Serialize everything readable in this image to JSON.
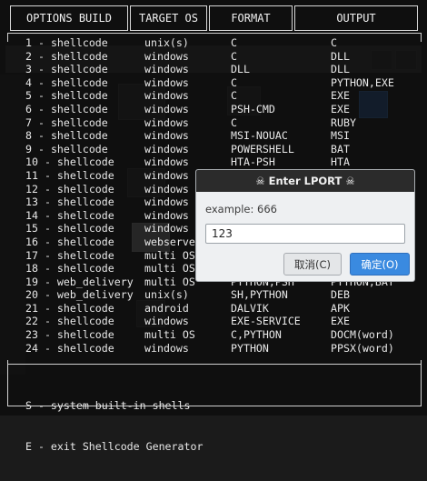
{
  "header": {
    "col1": "OPTIONS BUILD",
    "col2": "TARGET OS",
    "col3": "FORMAT",
    "col4": "OUTPUT"
  },
  "rows": [
    {
      "num": "1",
      "opt": "shellcode",
      "os": "unix(s)",
      "format": "C",
      "output": "C"
    },
    {
      "num": "2",
      "opt": "shellcode",
      "os": "windows",
      "format": "C",
      "output": "DLL"
    },
    {
      "num": "3",
      "opt": "shellcode",
      "os": "windows",
      "format": "DLL",
      "output": "DLL"
    },
    {
      "num": "4",
      "opt": "shellcode",
      "os": "windows",
      "format": "C",
      "output": "PYTHON,EXE"
    },
    {
      "num": "5",
      "opt": "shellcode",
      "os": "windows",
      "format": "C",
      "output": "EXE"
    },
    {
      "num": "6",
      "opt": "shellcode",
      "os": "windows",
      "format": "PSH-CMD",
      "output": "EXE"
    },
    {
      "num": "7",
      "opt": "shellcode",
      "os": "windows",
      "format": "C",
      "output": "RUBY"
    },
    {
      "num": "8",
      "opt": "shellcode",
      "os": "windows",
      "format": "MSI-NOUAC",
      "output": "MSI"
    },
    {
      "num": "9",
      "opt": "shellcode",
      "os": "windows",
      "format": "POWERSHELL",
      "output": "BAT"
    },
    {
      "num": "10",
      "opt": "shellcode",
      "os": "windows",
      "format": "HTA-PSH",
      "output": "HTA"
    },
    {
      "num": "11",
      "opt": "shellcode",
      "os": "windows",
      "format": "",
      "output": ""
    },
    {
      "num": "12",
      "opt": "shellcode",
      "os": "windows",
      "format": "",
      "output": ""
    },
    {
      "num": "13",
      "opt": "shellcode",
      "os": "windows",
      "format": "",
      "output": ""
    },
    {
      "num": "14",
      "opt": "shellcode",
      "os": "windows",
      "format": "",
      "output": ""
    },
    {
      "num": "15",
      "opt": "shellcode",
      "os": "windows",
      "format": "",
      "output": ""
    },
    {
      "num": "16",
      "opt": "shellcode",
      "os": "webserver",
      "format": "",
      "output": ""
    },
    {
      "num": "17",
      "opt": "shellcode",
      "os": "multi OS",
      "format": "",
      "output": ""
    },
    {
      "num": "18",
      "opt": "shellcode",
      "os": "multi OS",
      "format": "",
      "output": ""
    },
    {
      "num": "19",
      "opt": "web_delivery",
      "os": "multi OS",
      "format": "PYTHON,PSH",
      "output": "PYTHON,BAT"
    },
    {
      "num": "20",
      "opt": "web_delivery",
      "os": "unix(s)",
      "format": "SH,PYTHON",
      "output": "DEB"
    },
    {
      "num": "21",
      "opt": "shellcode",
      "os": "android",
      "format": "DALVIK",
      "output": "APK"
    },
    {
      "num": "22",
      "opt": "shellcode",
      "os": "windows",
      "format": "EXE-SERVICE",
      "output": "EXE"
    },
    {
      "num": "23",
      "opt": "shellcode",
      "os": "multi OS",
      "format": "C,PYTHON",
      "output": "DOCM(word)"
    },
    {
      "num": "24",
      "opt": "shellcode",
      "os": "windows",
      "format": "PYTHON",
      "output": "PPSX(word)"
    }
  ],
  "options": [
    "S - system built-in shells",
    "E - exit Shellcode Generator"
  ],
  "dialog": {
    "title": "☠ Enter LPORT ☠",
    "example": "example: 666",
    "input_value": "123",
    "cancel_label": "取消(C)",
    "ok_label": "确定(O)"
  },
  "colors": {
    "accent": "#3a8ae0",
    "terminal_bg": "#0c0c0c",
    "dialog_bg": "#eef0f2"
  }
}
